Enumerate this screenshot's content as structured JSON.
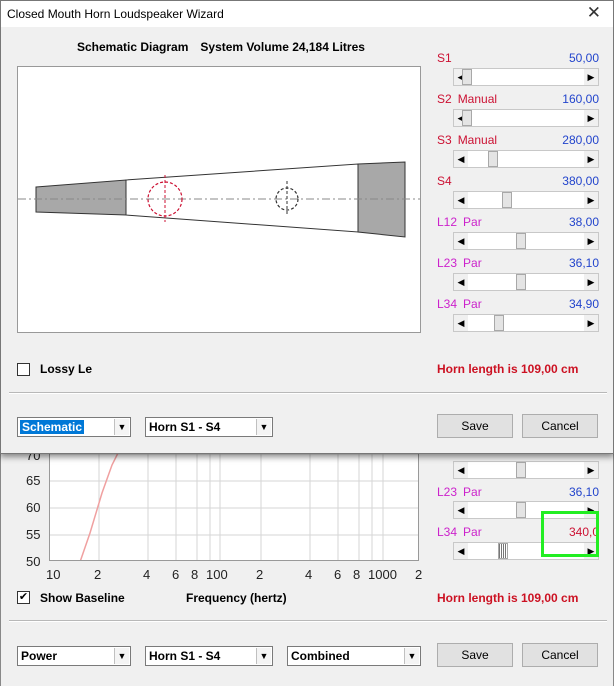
{
  "dialog": {
    "title": "Closed Mouth Horn Loudspeaker Wizard",
    "close_glyph": "✕",
    "caption_left": "Schematic Diagram",
    "caption_right": "System Volume 24,184 Litres",
    "sliders": [
      {
        "name": "S1",
        "qualifier": "",
        "value": "50,00",
        "color": "#cc1133",
        "thumb_pos": 0.05
      },
      {
        "name": "S2",
        "qualifier": "Manual",
        "value": "160,00",
        "color": "#cc1133",
        "thumb_pos": 0.06
      },
      {
        "name": "S3",
        "qualifier": "Manual",
        "value": "280,00",
        "color": "#cc1133",
        "thumb_pos": 0.26
      },
      {
        "name": "S4",
        "qualifier": "",
        "value": "380,00",
        "color": "#cc1133",
        "thumb_pos": 0.41
      },
      {
        "name": "L12",
        "qualifier": "Par",
        "value": "38,00",
        "color": "#cc22cc",
        "thumb_pos": 0.55
      },
      {
        "name": "L23",
        "qualifier": "Par",
        "value": "36,10",
        "color": "#cc22cc",
        "thumb_pos": 0.55
      },
      {
        "name": "L34",
        "qualifier": "Par",
        "value": "34,90",
        "color": "#cc22cc",
        "thumb_pos": 0.35
      }
    ],
    "lossy_label": "Lossy Le",
    "lossy_checked": false,
    "horn_length": "Horn length is 109,00 cm",
    "view_combo": "Schematic",
    "range_combo": "Horn S1 - S4",
    "save_label": "Save",
    "cancel_label": "Cancel"
  },
  "background": {
    "plot_y_ticks": [
      "70",
      "65",
      "60",
      "55",
      "50"
    ],
    "plot_x_ticks": [
      "10",
      "2",
      "4",
      "6",
      "8",
      "100",
      "2",
      "4",
      "6",
      "8",
      "1000",
      "2"
    ],
    "sliders": [
      {
        "name": "L23",
        "qualifier": "Par",
        "value": "36,10",
        "value_color": "#2244cc"
      },
      {
        "name": "L34",
        "qualifier": "Par",
        "value": "340,0",
        "value_color": "#cc1133"
      }
    ],
    "show_baseline_label": "Show Baseline",
    "show_baseline_checked": true,
    "frequency_label": "Frequency (hertz)",
    "horn_length": "Horn length is 109,00 cm",
    "combo_mode": "Power",
    "combo_range": "Horn S1 - S4",
    "combo_type": "Combined",
    "save_label": "Save",
    "cancel_label": "Cancel"
  }
}
